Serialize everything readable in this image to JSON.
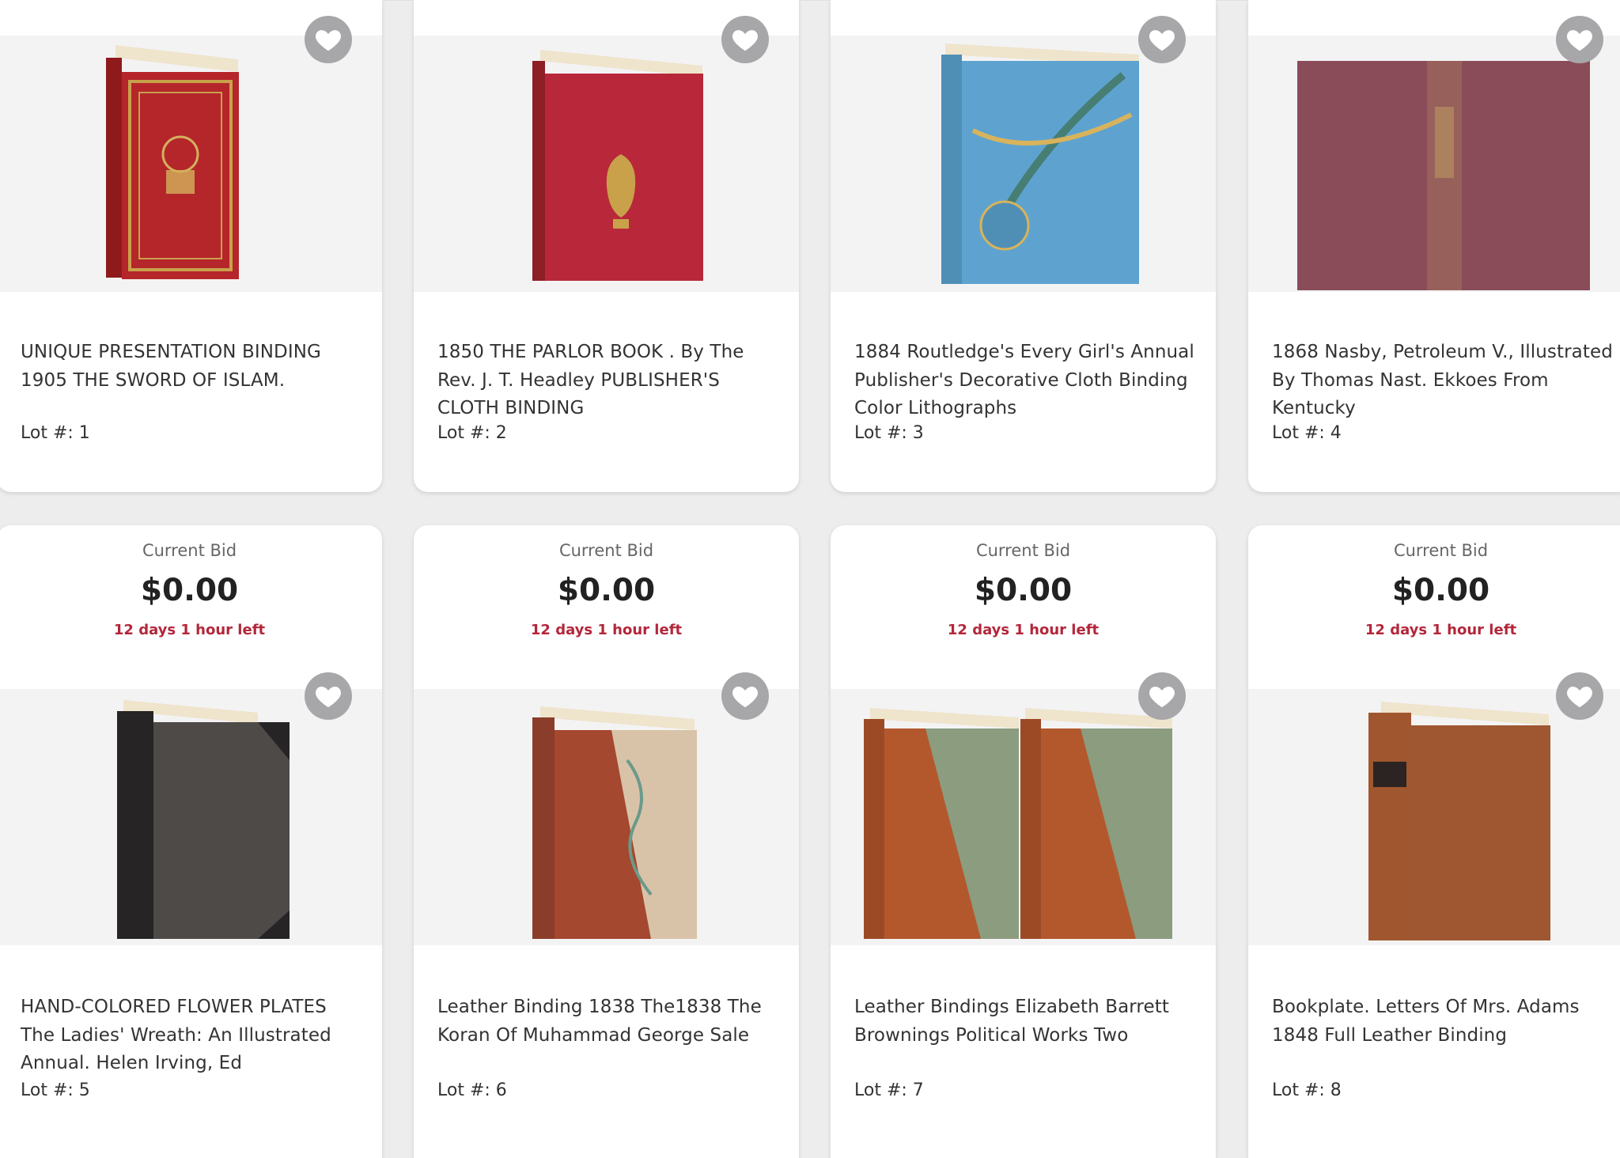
{
  "colors": {
    "accent": "#b3263a",
    "favorite_bg": "#a7a7a9"
  },
  "lots_top": [
    {
      "title": "UNIQUE PRESENTATION BINDING 1905 THE SWORD OF ISLAM.",
      "lot": "Lot #: 1",
      "favorite_icon": "heart-icon"
    },
    {
      "title": "1850 THE PARLOR BOOK . By The Rev. J. T. Headley PUBLISHER'S CLOTH BINDING",
      "lot": "Lot #: 2",
      "favorite_icon": "heart-icon"
    },
    {
      "title": "1884 Routledge's Every Girl's Annual Publisher's Decorative Cloth Binding Color Lithographs",
      "lot": "Lot #: 3",
      "favorite_icon": "heart-icon"
    },
    {
      "title": "1868 Nasby, Petroleum V., Illustrated By Thomas Nast. Ekkoes From Kentucky",
      "lot": "Lot #: 4",
      "favorite_icon": "heart-icon"
    }
  ],
  "lots_bottom": [
    {
      "bid_label": "Current Bid",
      "bid": "$0.00",
      "time_left": "12 days 1 hour left",
      "title": "HAND-COLORED FLOWER PLATES The Ladies' Wreath: An Illustrated Annual. Helen Irving, Ed",
      "lot": "Lot #: 5",
      "favorite_icon": "heart-icon"
    },
    {
      "bid_label": "Current Bid",
      "bid": "$0.00",
      "time_left": "12 days 1 hour left",
      "title": "Leather Binding 1838 The1838 The Koran Of Muhammad George Sale",
      "lot": "Lot #: 6",
      "favorite_icon": "heart-icon"
    },
    {
      "bid_label": "Current Bid",
      "bid": "$0.00",
      "time_left": "12 days 1 hour left",
      "title": "Leather Bindings Elizabeth Barrett Brownings Political Works Two",
      "lot": "Lot #: 7",
      "favorite_icon": "heart-icon"
    },
    {
      "bid_label": "Current Bid",
      "bid": "$0.00",
      "time_left": "12 days 1 hour left",
      "title": "Bookplate. Letters Of Mrs. Adams 1848 Full Leather Binding",
      "lot": "Lot #: 8",
      "favorite_icon": "heart-icon"
    }
  ]
}
